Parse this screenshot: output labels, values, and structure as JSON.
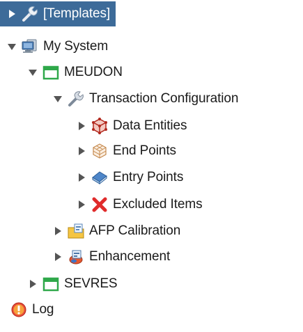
{
  "tree": {
    "templates": {
      "label": "[Templates]",
      "expanded": false,
      "selected": true,
      "icon": "wrench-icon"
    },
    "my_system": {
      "label": "My System",
      "expanded": true,
      "icon": "computer-icon"
    },
    "meudon": {
      "label": "MEUDON",
      "expanded": true,
      "icon": "green-folder-icon"
    },
    "transaction_configuration": {
      "label": "Transaction Configuration",
      "expanded": true,
      "icon": "wrench-icon"
    },
    "data_entities": {
      "label": "Data Entities",
      "expanded": false,
      "icon": "red-cube-icon"
    },
    "end_points": {
      "label": "End Points",
      "expanded": false,
      "icon": "wireframe-cube-icon"
    },
    "entry_points": {
      "label": "Entry Points",
      "expanded": false,
      "icon": "book-icon"
    },
    "excluded_items": {
      "label": "Excluded Items",
      "expanded": false,
      "icon": "red-x-icon"
    },
    "afp_calibration": {
      "label": "AFP Calibration",
      "expanded": false,
      "icon": "calibration-folder-icon"
    },
    "enhancement": {
      "label": "Enhancement",
      "expanded": false,
      "icon": "enhancement-icon"
    },
    "sevres": {
      "label": "SEVRES",
      "expanded": false,
      "icon": "green-folder-icon"
    },
    "log": {
      "label": "Log",
      "icon": "warning-icon"
    }
  },
  "colors": {
    "selection_background": "#3d6b99",
    "folder_green": "#2fa84a",
    "error_red": "#e02b2b"
  }
}
